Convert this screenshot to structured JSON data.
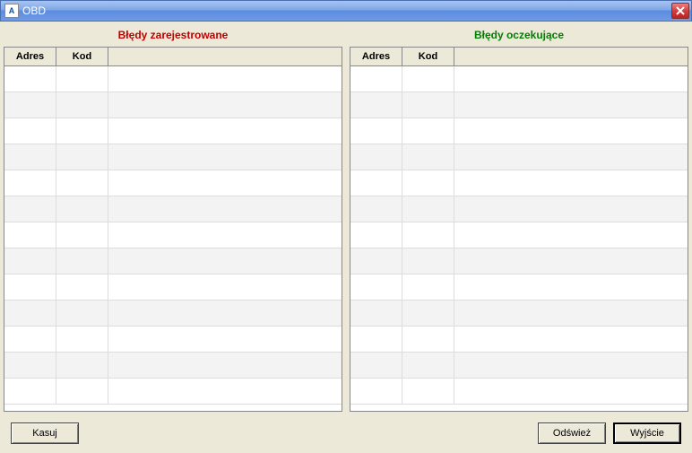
{
  "window": {
    "title": "OBD"
  },
  "panels": {
    "left": {
      "title": "Błędy zarejestrowane",
      "columns": {
        "adres": "Adres",
        "kod": "Kod",
        "desc": ""
      },
      "rows": [
        {
          "adres": "",
          "kod": "",
          "desc": ""
        },
        {
          "adres": "",
          "kod": "",
          "desc": ""
        },
        {
          "adres": "",
          "kod": "",
          "desc": ""
        },
        {
          "adres": "",
          "kod": "",
          "desc": ""
        },
        {
          "adres": "",
          "kod": "",
          "desc": ""
        },
        {
          "adres": "",
          "kod": "",
          "desc": ""
        },
        {
          "adres": "",
          "kod": "",
          "desc": ""
        },
        {
          "adres": "",
          "kod": "",
          "desc": ""
        },
        {
          "adres": "",
          "kod": "",
          "desc": ""
        },
        {
          "adres": "",
          "kod": "",
          "desc": ""
        },
        {
          "adres": "",
          "kod": "",
          "desc": ""
        },
        {
          "adres": "",
          "kod": "",
          "desc": ""
        },
        {
          "adres": "",
          "kod": "",
          "desc": ""
        }
      ]
    },
    "right": {
      "title": "Błędy oczekujące",
      "columns": {
        "adres": "Adres",
        "kod": "Kod",
        "desc": ""
      },
      "rows": [
        {
          "adres": "",
          "kod": "",
          "desc": ""
        },
        {
          "adres": "",
          "kod": "",
          "desc": ""
        },
        {
          "adres": "",
          "kod": "",
          "desc": ""
        },
        {
          "adres": "",
          "kod": "",
          "desc": ""
        },
        {
          "adres": "",
          "kod": "",
          "desc": ""
        },
        {
          "adres": "",
          "kod": "",
          "desc": ""
        },
        {
          "adres": "",
          "kod": "",
          "desc": ""
        },
        {
          "adres": "",
          "kod": "",
          "desc": ""
        },
        {
          "adres": "",
          "kod": "",
          "desc": ""
        },
        {
          "adres": "",
          "kod": "",
          "desc": ""
        },
        {
          "adres": "",
          "kod": "",
          "desc": ""
        },
        {
          "adres": "",
          "kod": "",
          "desc": ""
        },
        {
          "adres": "",
          "kod": "",
          "desc": ""
        }
      ]
    }
  },
  "buttons": {
    "delete": "Kasuj",
    "refresh": "Odśwież",
    "exit": "Wyjście"
  }
}
